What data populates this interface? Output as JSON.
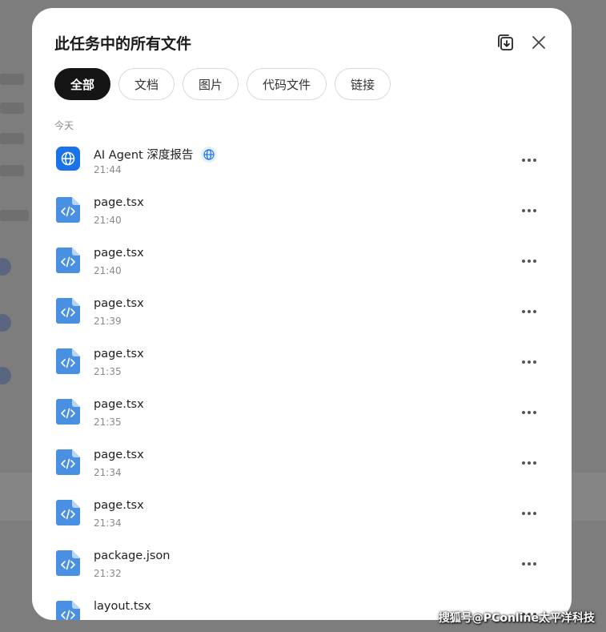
{
  "dialog": {
    "title": "此任务中的所有文件",
    "download_icon": "download-all-icon",
    "close_icon": "close-icon"
  },
  "filters": [
    {
      "label": "全部",
      "active": true
    },
    {
      "label": "文档",
      "active": false
    },
    {
      "label": "图片",
      "active": false
    },
    {
      "label": "代码文件",
      "active": false
    },
    {
      "label": "链接",
      "active": false
    }
  ],
  "section_label": "今天",
  "files": [
    {
      "name": "AI Agent 深度报告",
      "time": "21:44",
      "kind": "web",
      "icon": "globe-icon",
      "badge": "globe-icon"
    },
    {
      "name": "page.tsx",
      "time": "21:40",
      "kind": "code",
      "icon": "code-file-icon"
    },
    {
      "name": "page.tsx",
      "time": "21:40",
      "kind": "code",
      "icon": "code-file-icon"
    },
    {
      "name": "page.tsx",
      "time": "21:39",
      "kind": "code",
      "icon": "code-file-icon"
    },
    {
      "name": "page.tsx",
      "time": "21:35",
      "kind": "code",
      "icon": "code-file-icon"
    },
    {
      "name": "page.tsx",
      "time": "21:35",
      "kind": "code",
      "icon": "code-file-icon"
    },
    {
      "name": "page.tsx",
      "time": "21:34",
      "kind": "code",
      "icon": "code-file-icon"
    },
    {
      "name": "page.tsx",
      "time": "21:34",
      "kind": "code",
      "icon": "code-file-icon"
    },
    {
      "name": "package.json",
      "time": "21:32",
      "kind": "code",
      "icon": "code-file-icon"
    },
    {
      "name": "layout.tsx",
      "time": "",
      "kind": "code",
      "icon": "code-file-icon"
    }
  ],
  "watermark": "搜狐号@PConline太平洋科技",
  "colors": {
    "accent": "#1a73e8",
    "file_icon": "#4a90e2",
    "chip_active": "#151515"
  }
}
